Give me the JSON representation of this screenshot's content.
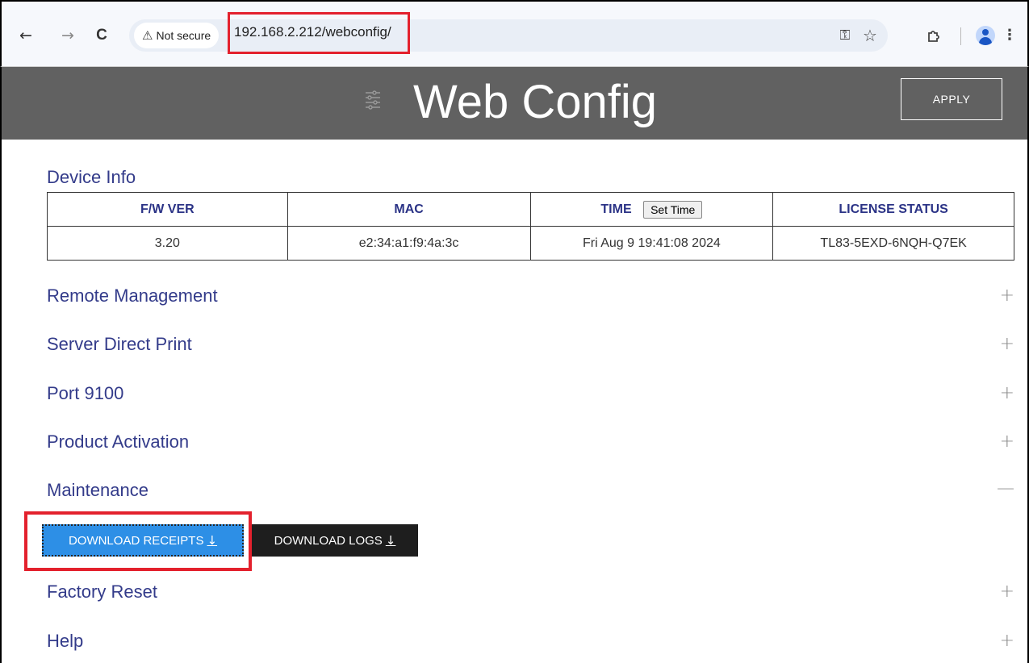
{
  "browser": {
    "nav": {
      "back": "←",
      "forward": "→",
      "reload": "C"
    },
    "security_label": "Not secure",
    "url": "192.168.2.212/webconfig/"
  },
  "header": {
    "title": "Web Config",
    "apply_label": "APPLY"
  },
  "device_info": {
    "title": "Device Info",
    "columns": {
      "fw_ver": "F/W VER",
      "mac": "MAC",
      "time": "TIME",
      "set_time_label": "Set Time",
      "license_status": "LICENSE STATUS"
    },
    "row": {
      "fw_ver": "3.20",
      "mac": "e2:34:a1:f9:4a:3c",
      "time": "Fri Aug 9 19:41:08 2024",
      "license_status": "TL83-5EXD-6NQH-Q7EK"
    }
  },
  "sections": {
    "remote_management": {
      "title": "Remote Management",
      "toggle": "+"
    },
    "server_direct_print": {
      "title": "Server Direct Print",
      "toggle": "+"
    },
    "port_9100": {
      "title": "Port 9100",
      "toggle": "+"
    },
    "product_activation": {
      "title": "Product Activation",
      "toggle": "+"
    },
    "maintenance": {
      "title": "Maintenance",
      "toggle": "—",
      "download_receipts_label": "DOWNLOAD RECEIPTS",
      "download_logs_label": "DOWNLOAD LOGS",
      "arrow": "↓"
    },
    "factory_reset": {
      "title": "Factory Reset",
      "toggle": "+"
    },
    "help": {
      "title": "Help",
      "toggle": "+"
    }
  },
  "colors": {
    "header_bg": "#616161",
    "section_title": "#333b8a",
    "highlight": "#e3212d",
    "primary_button": "#2d8fe6",
    "dark_button": "#1e1e1e"
  }
}
